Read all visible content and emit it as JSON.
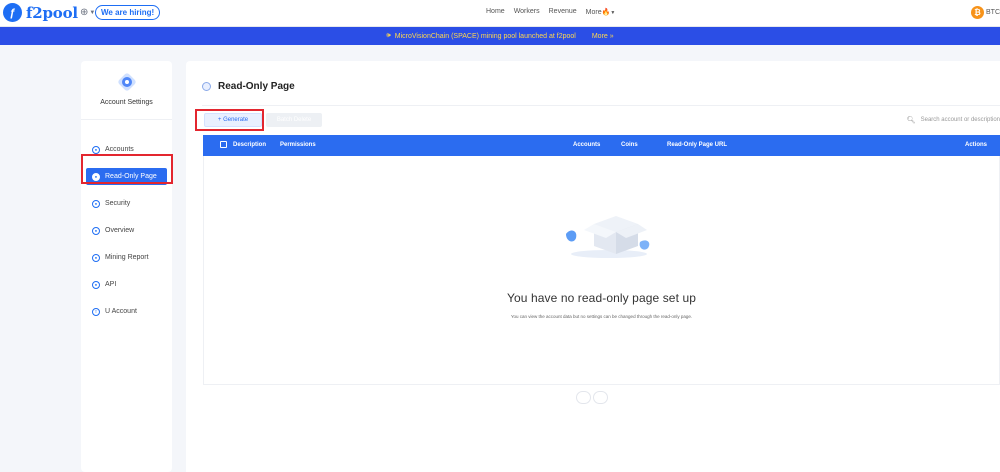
{
  "header": {
    "logo_text": "f2pool",
    "hiring_label": "We are hiring!",
    "nav": [
      "Home",
      "Workers",
      "Revenue",
      "More"
    ],
    "coin": "BTC"
  },
  "banner": {
    "text": "MicroVisionChain (SPACE) mining pool launched at f2pool",
    "more": "More »"
  },
  "sidebar": {
    "title": "Account Settings",
    "items": [
      {
        "label": "Accounts"
      },
      {
        "label": "Read-Only Page"
      },
      {
        "label": "Security"
      },
      {
        "label": "Overview"
      },
      {
        "label": "Mining Report"
      },
      {
        "label": "API"
      },
      {
        "label": "U Account"
      }
    ]
  },
  "main": {
    "title": "Read-Only Page",
    "generate_label": "+ Generate",
    "batch_delete_label": "Batch Delete",
    "search_placeholder": "Search account or description",
    "columns": [
      "Description",
      "Permissions",
      "Accounts",
      "Coins",
      "Read-Only Page URL",
      "Actions"
    ],
    "empty_title": "You have no read-only page set up",
    "empty_desc": "You can view the account data but no settings can be changed through the read-only page."
  },
  "colors": {
    "primary": "#2b6cf0",
    "banner": "#2b4ee6",
    "banner_text": "#ffd84d",
    "highlight": "#e3262f"
  }
}
